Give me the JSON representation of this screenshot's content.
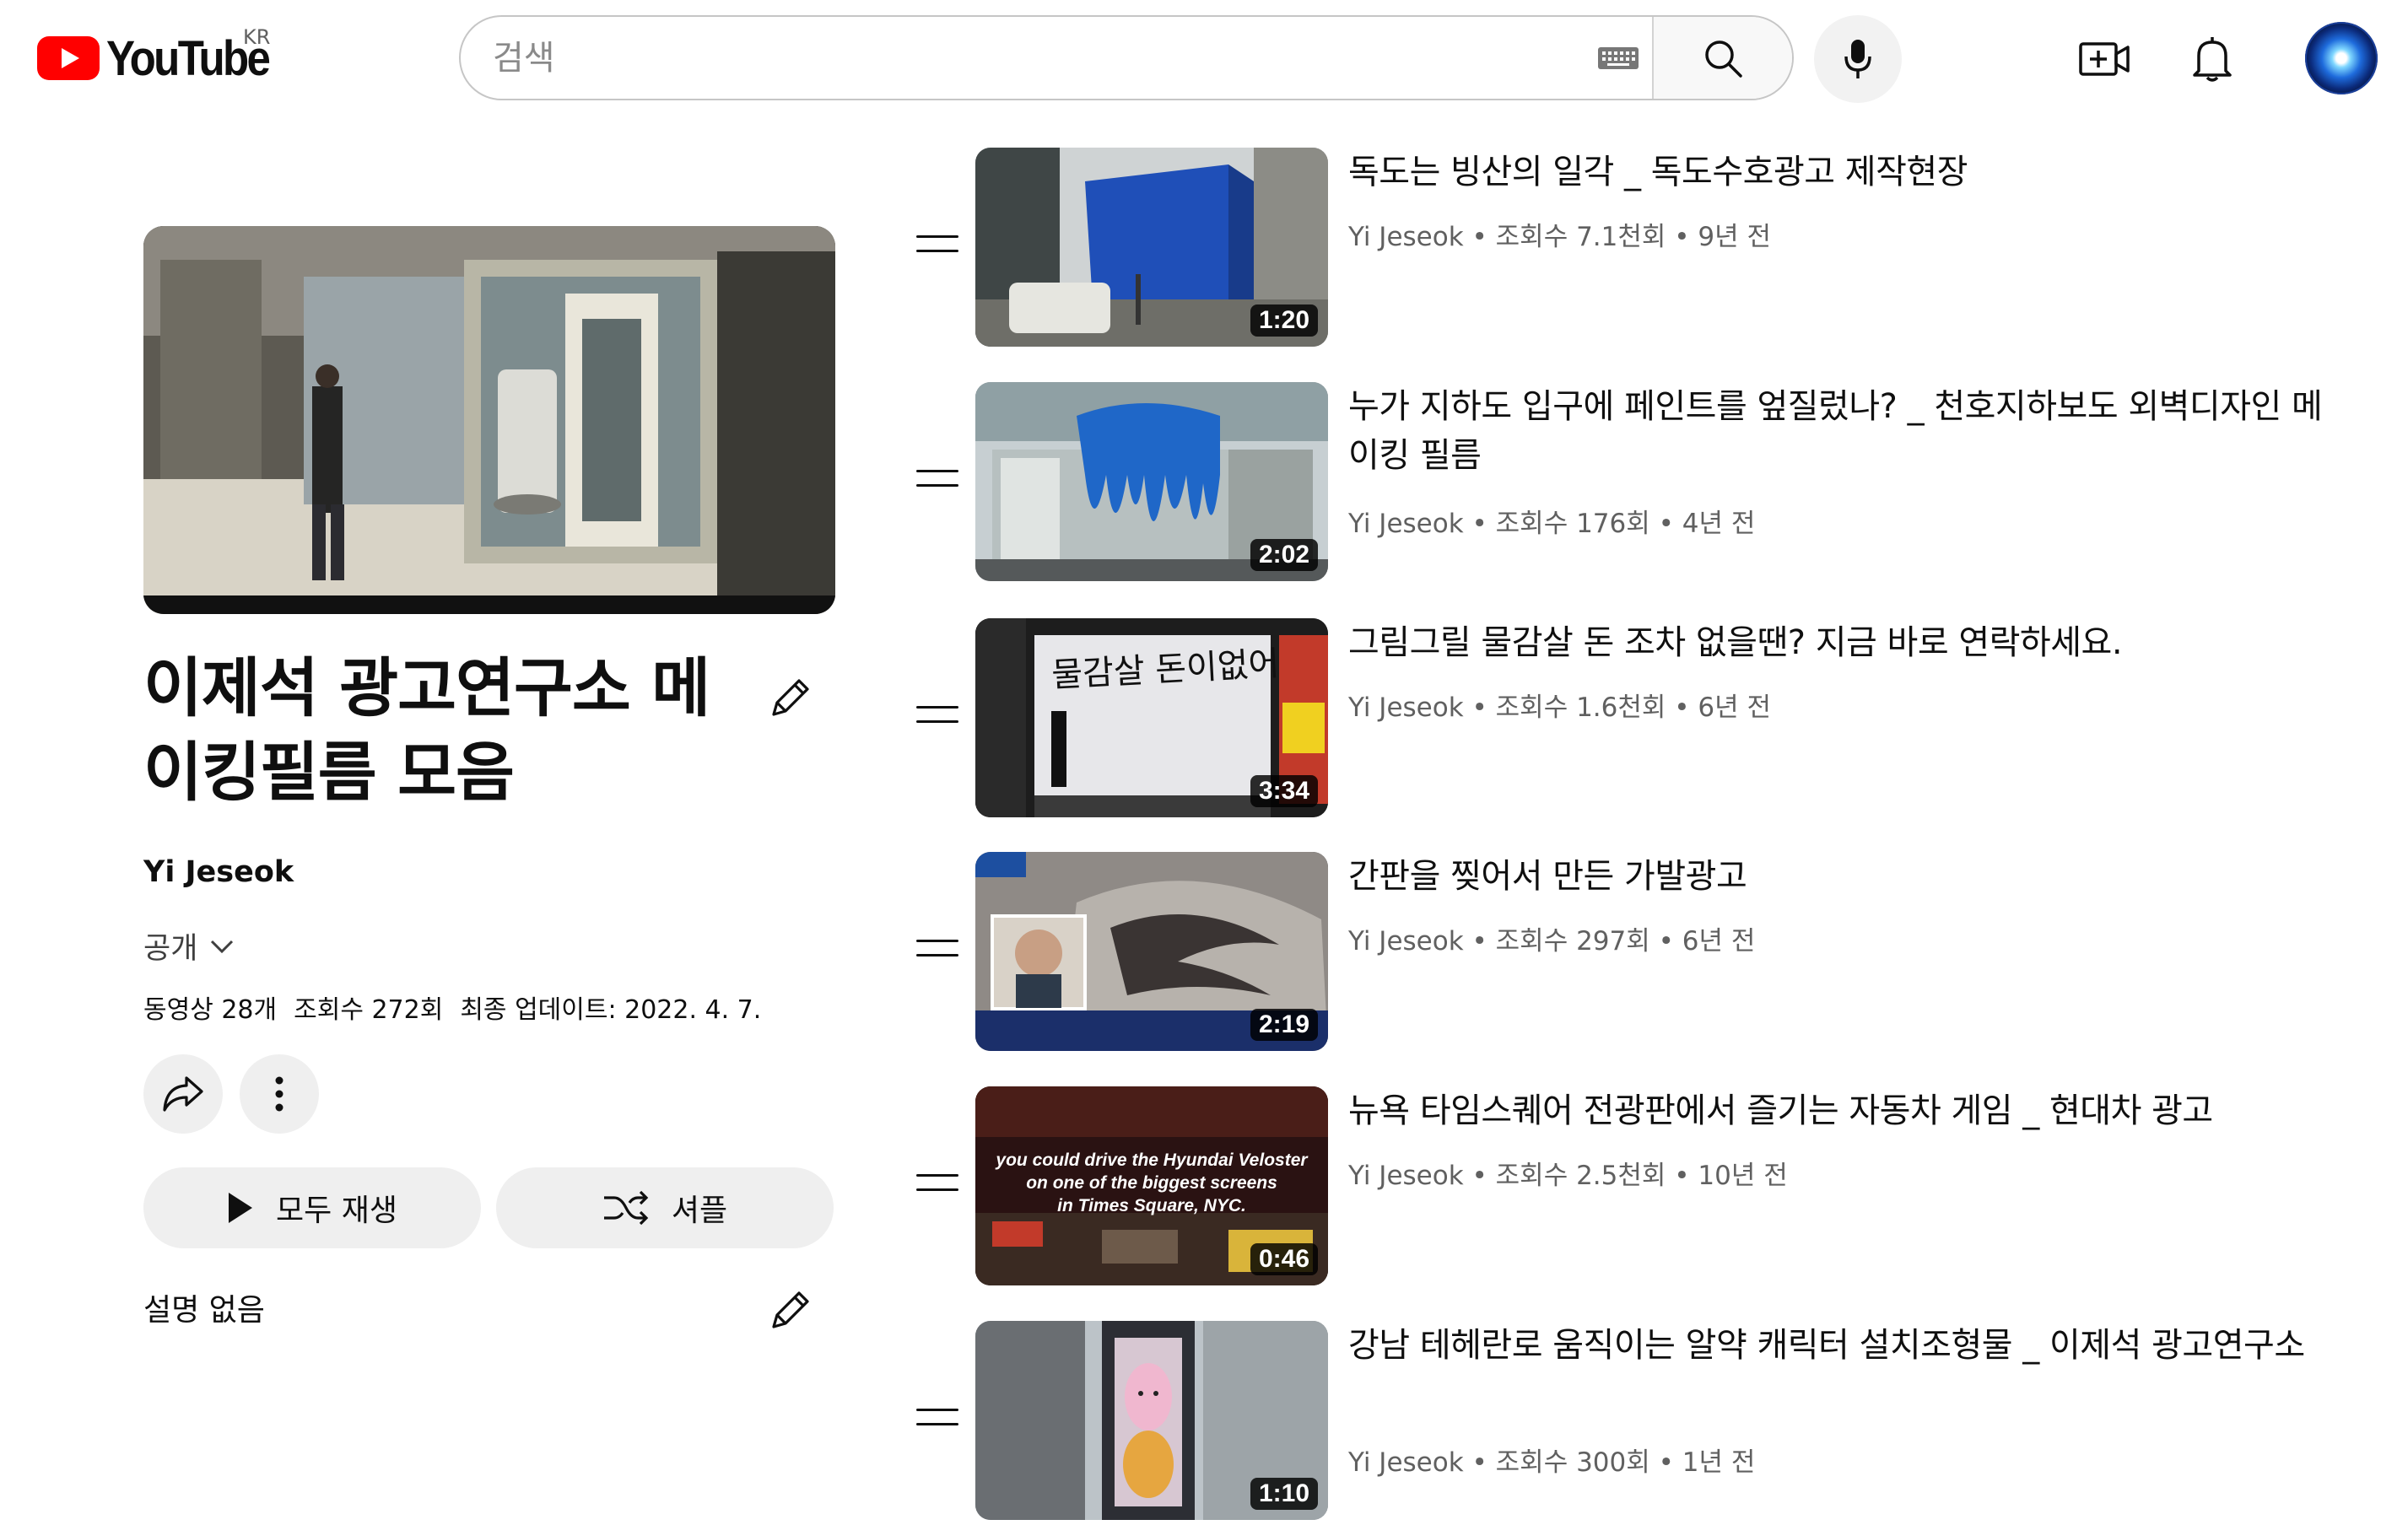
{
  "header": {
    "logo_text": "YouTube",
    "country_code": "KR",
    "search_placeholder": "검색",
    "icons": [
      "keyboard-icon",
      "search-icon",
      "mic-icon",
      "create-video-icon",
      "notifications-bell-icon",
      "account-avatar"
    ],
    "brand_color": "#ff0000"
  },
  "playlist": {
    "title": "이제석 광고연구소 메이킹필름 모음",
    "owner": "Yi Jeseok",
    "privacy": "공개",
    "video_count": "동영상 28개",
    "views": "조회수 272회",
    "last_updated": "최종 업데이트: 2022. 4. 7.",
    "play_all_label": "모두 재생",
    "shuffle_label": "셔플",
    "description": "설명 없음"
  },
  "videos": [
    {
      "title": "독도는 빙산의 일각 _ 독도수호광고 제작현장",
      "channel": "Yi Jeseok",
      "views": "조회수 7.1천회",
      "age": "9년 전",
      "duration": "1:20"
    },
    {
      "title": "누가 지하도 입구에 페인트를 엎질렀나? _ 천호지하보도 외벽디자인 메이킹 필름",
      "channel": "Yi Jeseok",
      "views": "조회수 176회",
      "age": "4년 전",
      "duration": "2:02"
    },
    {
      "title": "그림그릴 물감살 돈 조차 없을땐? 지금 바로 연락하세요.",
      "channel": "Yi Jeseok",
      "views": "조회수 1.6천회",
      "age": "6년 전",
      "duration": "3:34",
      "thumb_text": "물감살 돈이없어"
    },
    {
      "title": "간판을 찢어서 만든 가발광고",
      "channel": "Yi Jeseok",
      "views": "조회수 297회",
      "age": "6년 전",
      "duration": "2:19"
    },
    {
      "title": "뉴욕 타임스퀘어 전광판에서 즐기는 자동차 게임 _ 현대차 광고",
      "channel": "Yi Jeseok",
      "views": "조회수 2.5천회",
      "age": "10년 전",
      "duration": "0:46",
      "thumb_text": [
        "you could drive the Hyundai Veloster",
        "on one of the biggest screens",
        "in Times Square, NYC."
      ]
    },
    {
      "title": "강남 테헤란로 움직이는 알약 캐릭터 설치조형물 _ 이제석 광고연구소",
      "channel": "Yi Jeseok",
      "views": "조회수 300회",
      "age": "1년 전",
      "duration": "1:10"
    }
  ]
}
